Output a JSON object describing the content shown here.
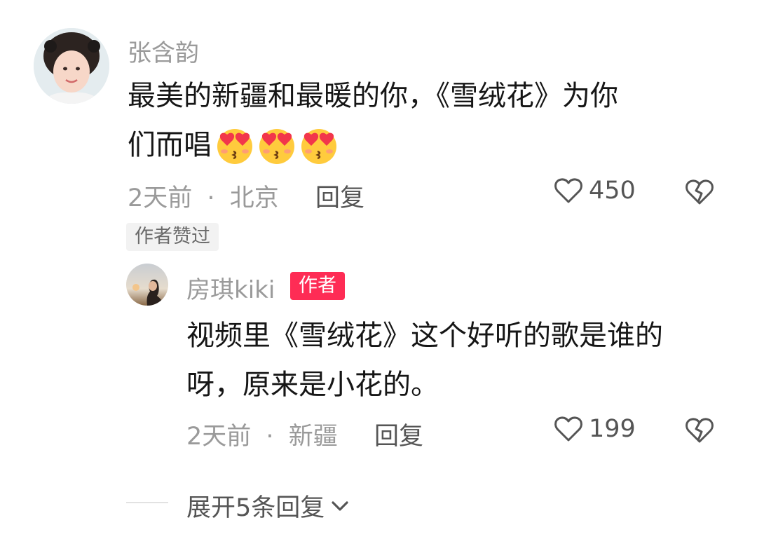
{
  "comment": {
    "username": "张含韵",
    "text_line1": "最美的新疆和最暖的你，《雪绒花》为你",
    "text_line2": "们而唱",
    "time": "2天前",
    "location": "北京",
    "reply_label": "回复",
    "like_count": "450",
    "author_liked": "作者赞过",
    "emoji_icon": "heart-eyes-kiss-emoji"
  },
  "reply": {
    "username": "房琪kiki",
    "author_badge": "作者",
    "text_line1": "视频里《雪绒花》这个好听的歌是谁的",
    "text_line2": "呀，原来是小花的。",
    "time": "2天前",
    "location": "新疆",
    "reply_label": "回复",
    "like_count": "199"
  },
  "expand": {
    "label": "展开5条回复"
  },
  "colors": {
    "accent": "#fe2c55",
    "meta": "#9a9a9a",
    "text": "#161616"
  }
}
